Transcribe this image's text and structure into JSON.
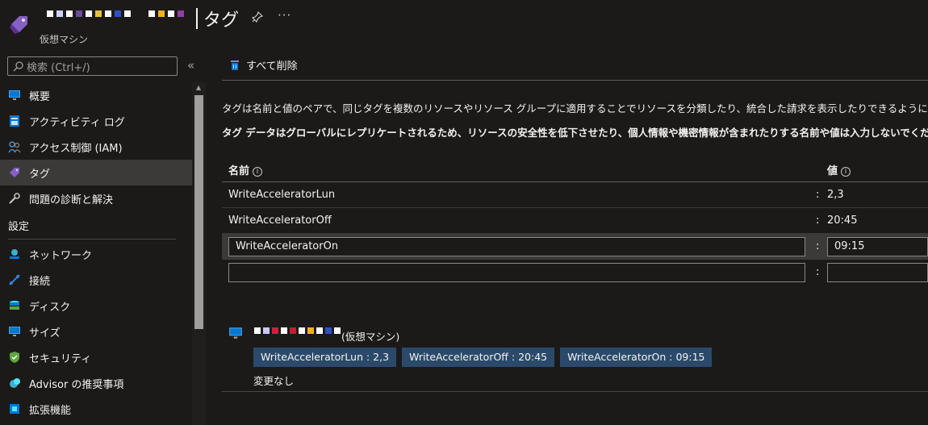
{
  "header": {
    "title": "タグ",
    "subtitle": "仮想マシン",
    "pin_icon": "pin-icon",
    "more_label": "···"
  },
  "sidebar": {
    "search_placeholder": "検索 (Ctrl+/)",
    "collapse_label": "«",
    "items_top": [
      {
        "label": "概要",
        "icon": "monitor-icon"
      },
      {
        "label": "アクティビティ ログ",
        "icon": "log-icon"
      },
      {
        "label": "アクセス制御 (IAM)",
        "icon": "people-icon"
      },
      {
        "label": "タグ",
        "icon": "tag-icon",
        "active": true
      },
      {
        "label": "問題の診断と解決",
        "icon": "wrench-icon"
      }
    ],
    "section_settings": "設定",
    "items_settings": [
      {
        "label": "ネットワーク",
        "icon": "network-icon"
      },
      {
        "label": "接続",
        "icon": "connect-icon"
      },
      {
        "label": "ディスク",
        "icon": "disk-icon"
      },
      {
        "label": "サイズ",
        "icon": "size-icon"
      },
      {
        "label": "セキュリティ",
        "icon": "shield-icon"
      },
      {
        "label": "Advisor の推奨事項",
        "icon": "advisor-icon"
      },
      {
        "label": "拡張機能",
        "icon": "extension-icon"
      }
    ]
  },
  "command_bar": {
    "delete_all_label": "すべて削除"
  },
  "description": {
    "line1": "タグは名前と値のペアで、同じタグを複数のリソースやリソース グループに適用することでリソースを分類したり、統合した請求を表示したりできるようにします。タグ名は大文字と小",
    "line2": "タグ データはグローバルにレプリケートされるため、リソースの安全性を低下させたり、個人情報や機密情報が含まれたりする名前や値は入力しないでください。"
  },
  "table": {
    "col_name": "名前",
    "col_value": "値",
    "colon": ":",
    "rows": [
      {
        "name": "WriteAcceleratorLun",
        "value": "2,3"
      },
      {
        "name": "WriteAcceleratorOff",
        "value": "20:45"
      }
    ],
    "edit_row": {
      "name": "WriteAcceleratorOn",
      "value": "09:15"
    },
    "new_row": {
      "name": "",
      "value": ""
    }
  },
  "summary": {
    "resource_type": "(仮想マシン)",
    "chips": [
      "WriteAcceleratorLun : 2,3",
      "WriteAcceleratorOff : 20:45",
      "WriteAcceleratorOn : 09:15"
    ],
    "status": "変更なし"
  },
  "colors": {
    "background": "#1b1a19",
    "active_nav": "#3b3a39",
    "chip": "#2b4a6b",
    "tag_icon": "#8661c5",
    "accent_blue": "#0078d4"
  }
}
